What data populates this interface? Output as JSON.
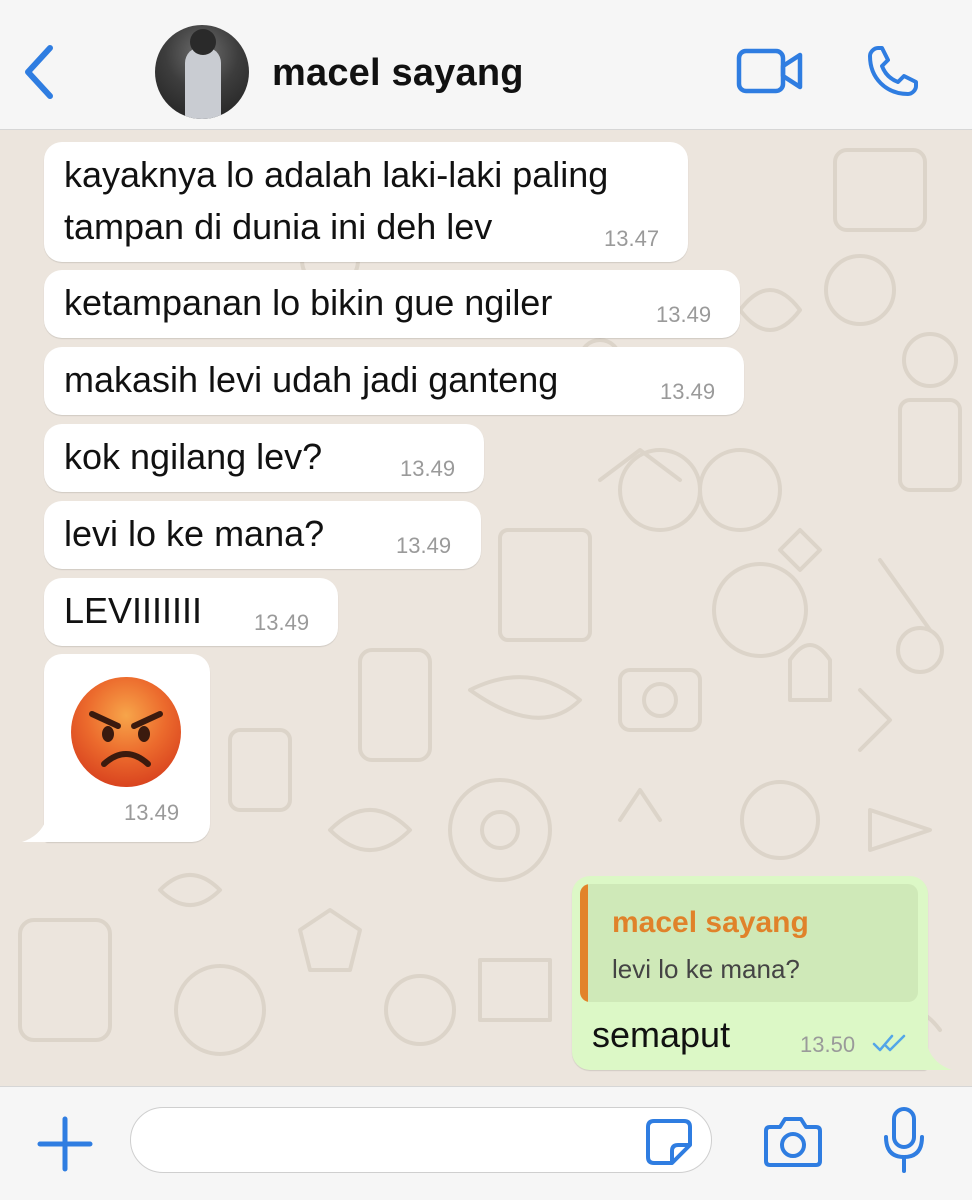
{
  "header": {
    "contact_name": "macel sayang",
    "back_icon": "chevron-left-icon",
    "video_icon": "video-camera-icon",
    "call_icon": "phone-icon"
  },
  "messages": [
    {
      "direction": "incoming",
      "lines": [
        "kayaknya lo adalah laki-laki paling",
        "tampan di dunia ini deh lev"
      ],
      "time": "13.47"
    },
    {
      "direction": "incoming",
      "text": "ketampanan lo bikin gue ngiler",
      "time": "13.49"
    },
    {
      "direction": "incoming",
      "text": "makasih levi udah jadi ganteng",
      "time": "13.49"
    },
    {
      "direction": "incoming",
      "text": "kok ngilang lev?",
      "time": "13.49"
    },
    {
      "direction": "incoming",
      "text": "levi lo ke mana?",
      "time": "13.49"
    },
    {
      "direction": "incoming",
      "text": "LEVIIIIIII",
      "time": "13.49"
    },
    {
      "direction": "incoming",
      "emoji": "angry-face-emoji",
      "time": "13.49"
    },
    {
      "direction": "outgoing",
      "reply_to": {
        "author": "macel sayang",
        "text": "levi lo ke mana?"
      },
      "text": "semaput",
      "time": "13.50",
      "status": "read"
    }
  ],
  "composer": {
    "placeholder": "",
    "value": "",
    "add_icon": "plus-icon",
    "sticker_icon": "sticker-icon",
    "camera_icon": "camera-icon",
    "mic_icon": "microphone-icon"
  },
  "colors": {
    "accent": "#2f7de1",
    "incoming_bubble": "#ffffff",
    "outgoing_bubble": "#dcf8c6",
    "quote_author": "#e0822a",
    "read_ticks": "#53a6e8",
    "chat_background": "#ece5dd"
  }
}
